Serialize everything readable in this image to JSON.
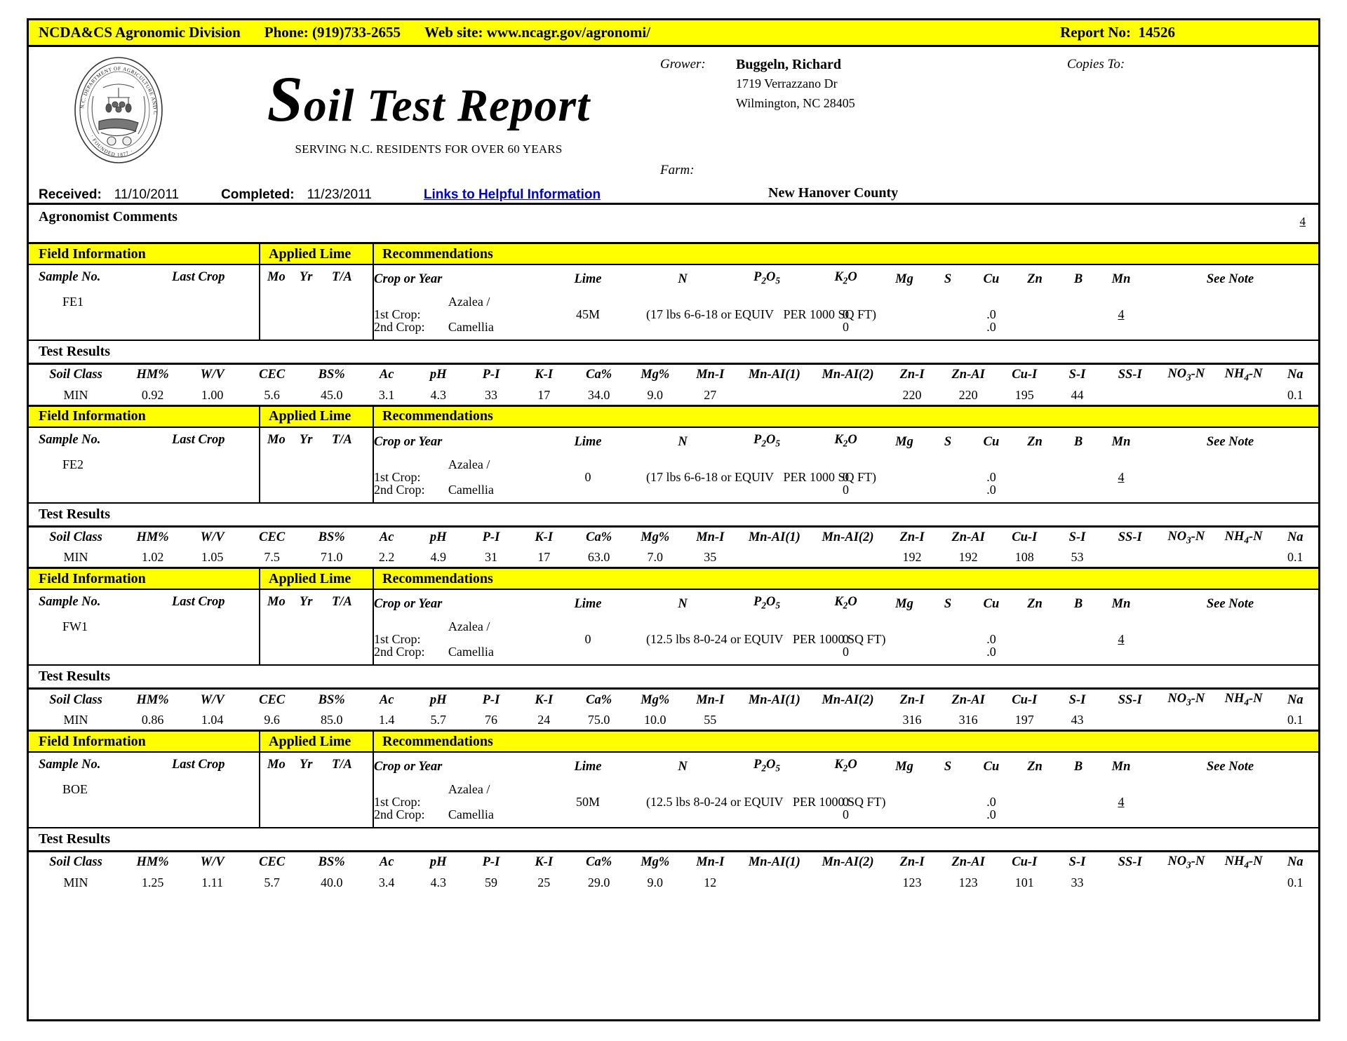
{
  "topbar": {
    "agency": "NCDA&CS Agronomic Division",
    "phone": "Phone: (919)733-2655",
    "website": "Web site: www.ncagr.gov/agronomi/",
    "report_no_label": "Report No:",
    "report_no": "14526",
    "background_color": "#ffff00"
  },
  "masthead": {
    "title_first_letter": "S",
    "title_rest": "oil Test Report",
    "subtitle": "SERVING N.C. RESIDENTS FOR OVER 60 YEARS",
    "seal_text_top": "N.C. DEPARTMENT OF AGRICULTURE AND CONSUMER SERVICES",
    "seal_text_bottom": "· FOUNDED 1877 ·"
  },
  "grower": {
    "label": "Grower:",
    "name": "Buggeln, Richard",
    "address1": "1719 Verrazzano Dr",
    "address2": "Wilmington, NC  28405",
    "farm_label": "Farm:",
    "farm_value": "",
    "copies_to_label": "Copies To:",
    "copies_to_value": ""
  },
  "dates": {
    "received_label": "Received:",
    "received_value": "11/10/2011",
    "completed_label": "Completed:",
    "completed_value": "11/23/2011",
    "links_label": "Links to Helpful Information",
    "links_color": "#0000cc",
    "county": "New Hanover County"
  },
  "comments": {
    "label": "Agronomist Comments",
    "note_ref": "4"
  },
  "band_labels": {
    "field_information": "Field Information",
    "applied_lime": "Applied Lime",
    "recommendations": "Recommendations",
    "test_results": "Test Results"
  },
  "field_headers": {
    "sample_no": "Sample No.",
    "last_crop": "Last Crop",
    "mo": "Mo",
    "yr": "Yr",
    "ta": "T/A",
    "crop_or_year": "Crop or Year",
    "lime": "Lime",
    "n": "N",
    "p2o5": "P2O5",
    "k2o": "K2O",
    "mg": "Mg",
    "s": "S",
    "cu": "Cu",
    "zn": "Zn",
    "b": "B",
    "mn": "Mn",
    "see_note": "See Note"
  },
  "test_headers": [
    "Soil Class",
    "HM%",
    "W/V",
    "CEC",
    "BS%",
    "Ac",
    "pH",
    "P-I",
    "K-I",
    "Ca%",
    "Mg%",
    "Mn-I",
    "Mn-AI(1)",
    "Mn-AI(2)",
    "Zn-I",
    "Zn-AI",
    "Cu-I",
    "S-I",
    "SS-I",
    "NO3-N",
    "NH4-N",
    "Na"
  ],
  "crop_row_labels": {
    "first": "1st Crop:",
    "second": "2nd Crop:"
  },
  "samples": [
    {
      "sample_no": "FE1",
      "last_crop": "",
      "applied_lime": {
        "mo": "",
        "yr": "",
        "ta": ""
      },
      "crop1": {
        "name": "Azalea / Camellia",
        "lime": "45M",
        "fertilizer": "(17 lbs 6-6-18 or EQUIV",
        "rate": "PER 1000 SQ FT)",
        "mg": "0",
        "s": "",
        "cu": "",
        "zn": ".0",
        "b": "",
        "mn": "",
        "see_note": "4"
      },
      "crop2": {
        "name": "",
        "lime": "",
        "fertilizer": "",
        "rate": "",
        "mg": "0",
        "s": "",
        "cu": "",
        "zn": ".0",
        "b": "",
        "mn": "",
        "see_note": ""
      },
      "test_results": [
        "MIN",
        "0.92",
        "1.00",
        "5.6",
        "45.0",
        "3.1",
        "4.3",
        "33",
        "17",
        "34.0",
        "9.0",
        "27",
        "",
        "",
        "220",
        "220",
        "195",
        "44",
        "",
        "",
        "",
        "0.1"
      ]
    },
    {
      "sample_no": "FE2",
      "last_crop": "",
      "applied_lime": {
        "mo": "",
        "yr": "",
        "ta": ""
      },
      "crop1": {
        "name": "Azalea / Camellia",
        "lime": "0",
        "fertilizer": "(17 lbs 6-6-18 or EQUIV",
        "rate": "PER 1000 SQ FT)",
        "mg": "0",
        "s": "",
        "cu": "",
        "zn": ".0",
        "b": "",
        "mn": "",
        "see_note": "4"
      },
      "crop2": {
        "name": "",
        "lime": "",
        "fertilizer": "",
        "rate": "",
        "mg": "0",
        "s": "",
        "cu": "",
        "zn": ".0",
        "b": "",
        "mn": "",
        "see_note": ""
      },
      "test_results": [
        "MIN",
        "1.02",
        "1.05",
        "7.5",
        "71.0",
        "2.2",
        "4.9",
        "31",
        "17",
        "63.0",
        "7.0",
        "35",
        "",
        "",
        "192",
        "192",
        "108",
        "53",
        "",
        "",
        "",
        "0.1"
      ]
    },
    {
      "sample_no": "FW1",
      "last_crop": "",
      "applied_lime": {
        "mo": "",
        "yr": "",
        "ta": ""
      },
      "crop1": {
        "name": "Azalea / Camellia",
        "lime": "0",
        "fertilizer": "(12.5 lbs 8-0-24 or EQUIV",
        "rate": "PER 1000 SQ FT)",
        "mg": "0",
        "s": "",
        "cu": "",
        "zn": ".0",
        "b": "",
        "mn": "",
        "see_note": "4"
      },
      "crop2": {
        "name": "",
        "lime": "",
        "fertilizer": "",
        "rate": "",
        "mg": "0",
        "s": "",
        "cu": "",
        "zn": ".0",
        "b": "",
        "mn": "",
        "see_note": ""
      },
      "test_results": [
        "MIN",
        "0.86",
        "1.04",
        "9.6",
        "85.0",
        "1.4",
        "5.7",
        "76",
        "24",
        "75.0",
        "10.0",
        "55",
        "",
        "",
        "316",
        "316",
        "197",
        "43",
        "",
        "",
        "",
        "0.1"
      ]
    },
    {
      "sample_no": "BOE",
      "last_crop": "",
      "applied_lime": {
        "mo": "",
        "yr": "",
        "ta": ""
      },
      "crop1": {
        "name": "Azalea / Camellia",
        "lime": "50M",
        "fertilizer": "(12.5 lbs 8-0-24 or EQUIV",
        "rate": "PER 1000 SQ FT)",
        "mg": "0",
        "s": "",
        "cu": "",
        "zn": ".0",
        "b": "",
        "mn": "",
        "see_note": "4"
      },
      "crop2": {
        "name": "",
        "lime": "",
        "fertilizer": "",
        "rate": "",
        "mg": "0",
        "s": "",
        "cu": "",
        "zn": ".0",
        "b": "",
        "mn": "",
        "see_note": ""
      },
      "test_results": [
        "MIN",
        "1.25",
        "1.11",
        "5.7",
        "40.0",
        "3.4",
        "4.3",
        "59",
        "25",
        "29.0",
        "9.0",
        "12",
        "",
        "",
        "123",
        "123",
        "101",
        "33",
        "",
        "",
        "",
        "0.1"
      ]
    }
  ]
}
